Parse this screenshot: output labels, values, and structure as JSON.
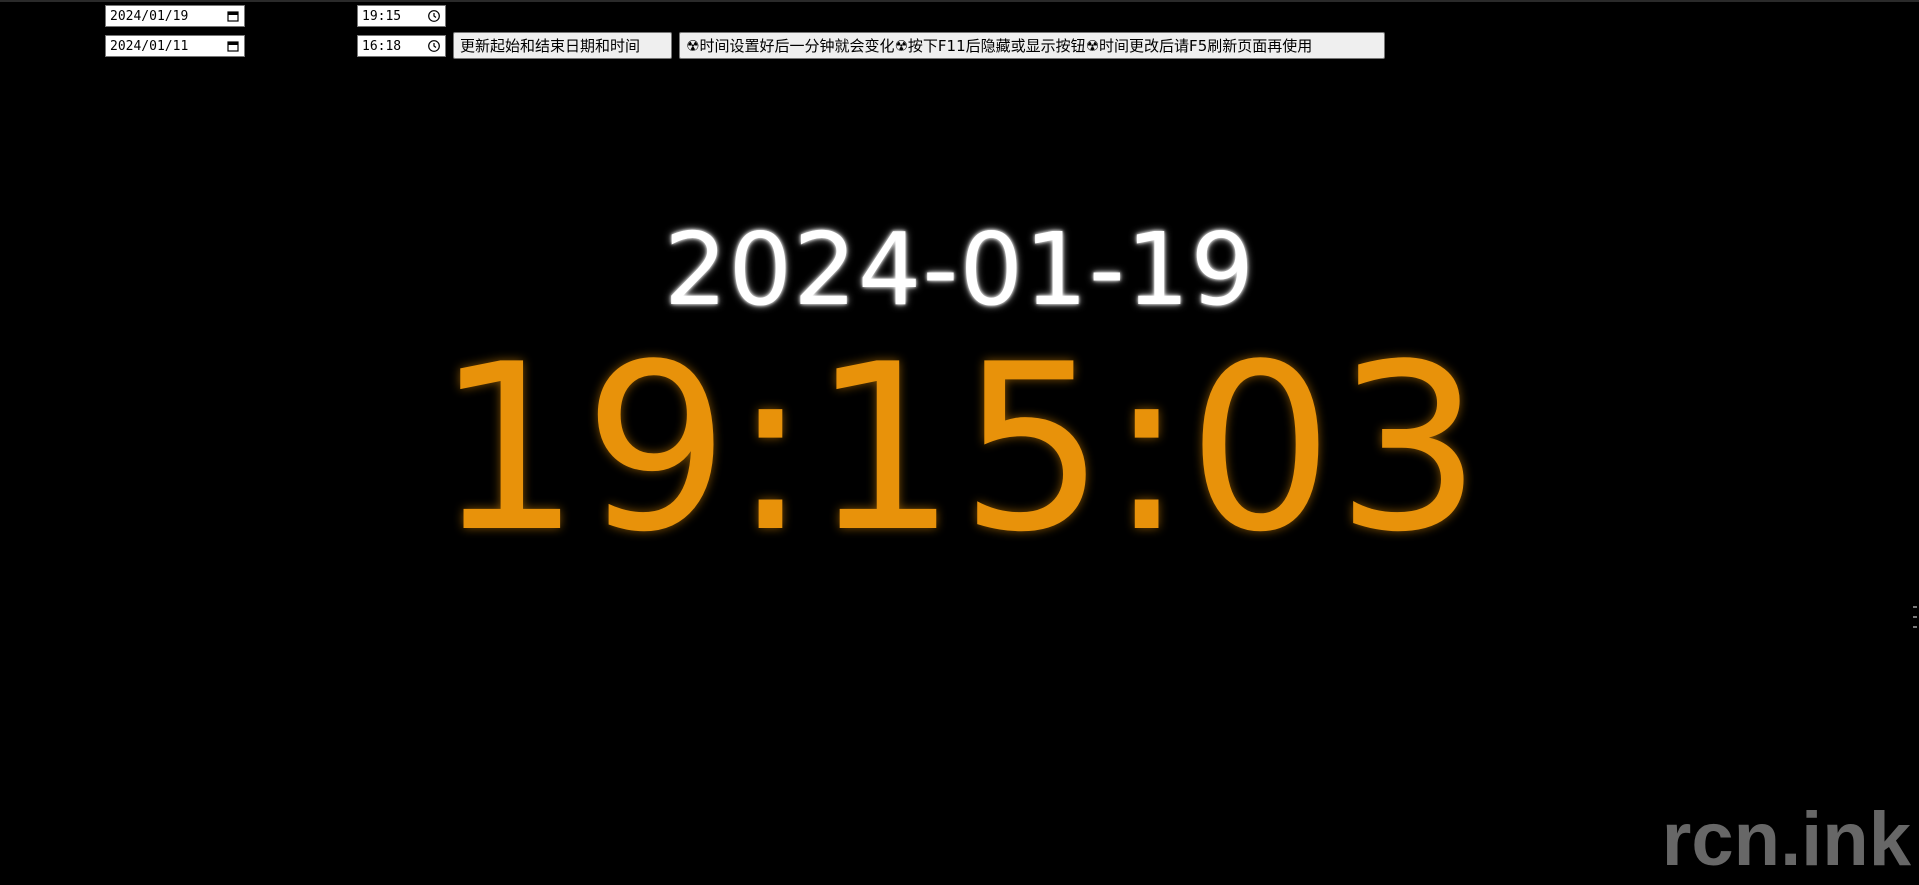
{
  "controls": {
    "start_date": "2024/01/19",
    "end_date": "2024/01/11",
    "start_time": "19:15",
    "end_time": "16:18",
    "date_icon": "calendar-icon",
    "time_icon": "clock-icon",
    "update_button_label": "更新起始和结束日期和时间",
    "hint_button_label": "☢时间设置好后一分钟就会变化☢按下F11后隐藏或显示按钮☢时间更改后请F5刷新页面再使用"
  },
  "display": {
    "date": "2024-01-19",
    "time": "19:15:03",
    "date_color": "#ffffff",
    "time_color": "#e8920a",
    "background": "#000000"
  },
  "watermark": {
    "text": "rcn.ink"
  }
}
